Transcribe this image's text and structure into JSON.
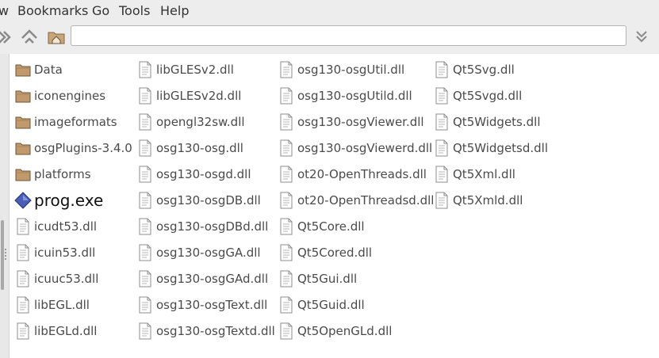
{
  "menu": [
    {
      "label": "w"
    },
    {
      "label": "Bookmarks"
    },
    {
      "label": "Go"
    },
    {
      "label": "Tools"
    },
    {
      "label": "Help"
    }
  ],
  "address": {
    "value": ""
  },
  "files": [
    {
      "name": "Data",
      "type": "folder"
    },
    {
      "name": "iconengines",
      "type": "folder"
    },
    {
      "name": "imageformats",
      "type": "folder"
    },
    {
      "name": "osgPlugins-3.4.0",
      "type": "folder"
    },
    {
      "name": "platforms",
      "type": "folder"
    },
    {
      "name": "prog.exe",
      "type": "exe"
    },
    {
      "name": "icudt53.dll",
      "type": "file"
    },
    {
      "name": "icuin53.dll",
      "type": "file"
    },
    {
      "name": "icuuc53.dll",
      "type": "file"
    },
    {
      "name": "libEGL.dll",
      "type": "file"
    },
    {
      "name": "libEGLd.dll",
      "type": "file"
    },
    {
      "name": "libGLESv2.dll",
      "type": "file"
    },
    {
      "name": "libGLESv2d.dll",
      "type": "file"
    },
    {
      "name": "opengl32sw.dll",
      "type": "file"
    },
    {
      "name": "osg130-osg.dll",
      "type": "file"
    },
    {
      "name": "osg130-osgd.dll",
      "type": "file"
    },
    {
      "name": "osg130-osgDB.dll",
      "type": "file"
    },
    {
      "name": "osg130-osgDBd.dll",
      "type": "file"
    },
    {
      "name": "osg130-osgGA.dll",
      "type": "file"
    },
    {
      "name": "osg130-osgGAd.dll",
      "type": "file"
    },
    {
      "name": "osg130-osgText.dll",
      "type": "file"
    },
    {
      "name": "osg130-osgTextd.dll",
      "type": "file"
    },
    {
      "name": "osg130-osgUtil.dll",
      "type": "file"
    },
    {
      "name": "osg130-osgUtild.dll",
      "type": "file"
    },
    {
      "name": "osg130-osgViewer.dll",
      "type": "file"
    },
    {
      "name": "osg130-osgViewerd.dll",
      "type": "file"
    },
    {
      "name": "ot20-OpenThreads.dll",
      "type": "file"
    },
    {
      "name": "ot20-OpenThreadsd.dll",
      "type": "file"
    },
    {
      "name": "Qt5Core.dll",
      "type": "file"
    },
    {
      "name": "Qt5Cored.dll",
      "type": "file"
    },
    {
      "name": "Qt5Gui.dll",
      "type": "file"
    },
    {
      "name": "Qt5Guid.dll",
      "type": "file"
    },
    {
      "name": "Qt5OpenGLd.dll",
      "type": "file"
    },
    {
      "name": "Qt5Svg.dll",
      "type": "file"
    },
    {
      "name": "Qt5Svgd.dll",
      "type": "file"
    },
    {
      "name": "Qt5Widgets.dll",
      "type": "file"
    },
    {
      "name": "Qt5Widgetsd.dll",
      "type": "file"
    },
    {
      "name": "Qt5Xml.dll",
      "type": "file"
    },
    {
      "name": "Qt5Xmld.dll",
      "type": "file"
    }
  ]
}
